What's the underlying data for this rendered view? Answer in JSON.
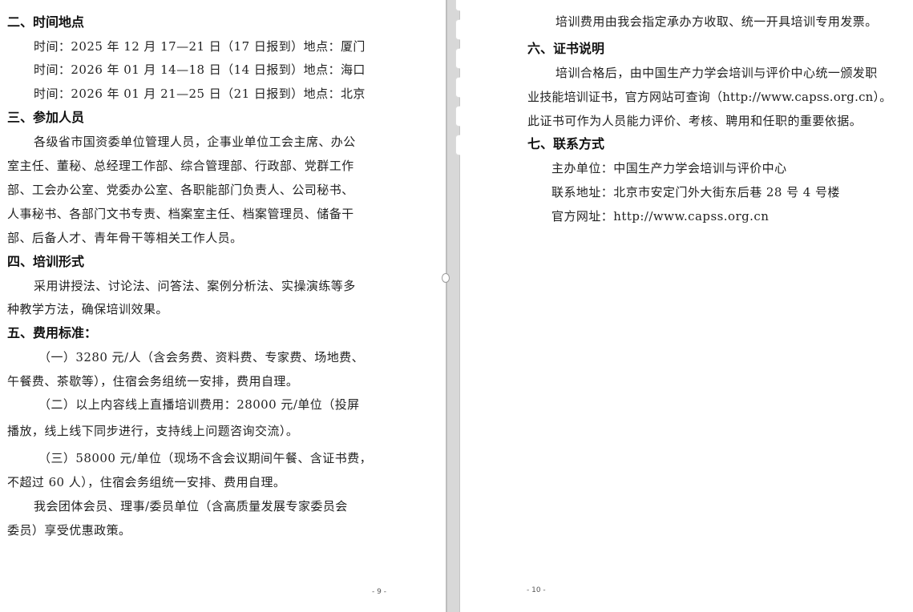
{
  "left_page": {
    "sections": {
      "time_place": {
        "heading": "二、时间地点",
        "lines": [
          "时间：2025 年 12 月 17—21 日（17 日报到）地点：厦门",
          "时间：2026 年 01 月 14—18 日（14 日报到）地点：海口",
          "时间：2026 年 01 月 21—25 日（21 日报到）地点：北京"
        ]
      },
      "participants": {
        "heading": "三、参加人员",
        "lines": [
          "各级省市国资委单位管理人员，企事业单位工会主席、办公",
          "室主任、董秘、总经理工作部、综合管理部、行政部、党群工作",
          "部、工会办公室、党委办公室、各职能部门负责人、公司秘书、",
          "人事秘书、各部门文书专责、档案室主任、档案管理员、储备干",
          "部、后备人才、青年骨干等相关工作人员。"
        ]
      },
      "format": {
        "heading": "四、培训形式",
        "lines": [
          "采用讲授法、讨论法、问答法、案例分析法、实操演练等多",
          "种教学方法，确保培训效果。"
        ]
      },
      "fees": {
        "heading": "五、费用标准：",
        "lines": [
          "（一）3280 元/人（含会务费、资料费、专家费、场地费、",
          "午餐费、茶歇等），住宿会务组统一安排，费用自理。",
          "（二）以上内容线上直播培训费用：28000 元/单位（投屏",
          "播放，线上线下同步进行，支持线上问题咨询交流）。",
          "（三）58000 元/单位（现场不含会议期间午餐、含证书费，",
          "不超过 60 人），住宿会务组统一安排、费用自理。",
          "我会团体会员、理事/委员单位（含高质量发展专家委员会",
          "委员）享受优惠政策。"
        ]
      }
    },
    "page_number": "- 9 -"
  },
  "right_page": {
    "intro_line": "培训费用由我会指定承办方收取、统一开具培训专用发票。",
    "certificate": {
      "heading": "六、证书说明",
      "lines": [
        "培训合格后，由中国生产力学会培训与评价中心统一颁发职",
        "业技能培训证书，官方网站可查询（http://www.capss.org.cn）。",
        "此证书可作为人员能力评价、考核、聘用和任职的重要依据。"
      ]
    },
    "contact": {
      "heading": "七、联系方式",
      "lines": [
        "主办单位：中国生产力学会培训与评价中心",
        "联系地址：北京市安定门外大街东后巷 28 号 4 号楼",
        "官方网址：http://www.capss.org.cn"
      ]
    },
    "page_number": "- 10 -"
  },
  "toolbar": {
    "icons": [
      "text-icon",
      "crop-icon",
      "zoom-in-icon",
      "rotate-icon",
      "ocr-icon",
      "more-icon"
    ]
  }
}
